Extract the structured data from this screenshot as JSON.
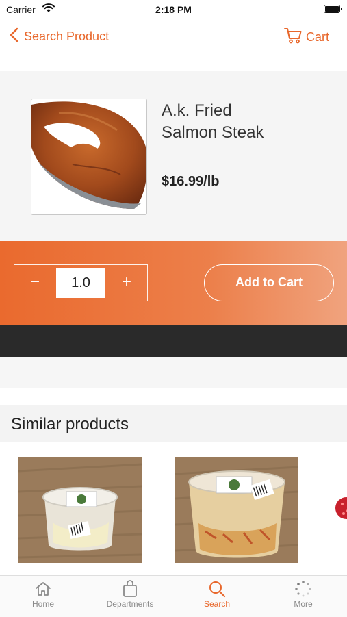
{
  "status_bar": {
    "carrier": "Carrier",
    "time": "2:18 PM"
  },
  "nav": {
    "back_label": "Search Product",
    "cart_label": "Cart"
  },
  "product": {
    "name_line1": "A.k. Fried",
    "name_line2": "Salmon Steak",
    "price": "$16.99/lb"
  },
  "quantity": {
    "minus": "−",
    "value": "1.0",
    "plus": "+"
  },
  "add_to_cart": "Add to Cart",
  "similar": {
    "title": "Similar products"
  },
  "tabs": [
    {
      "label": "Home",
      "icon": "home-icon"
    },
    {
      "label": "Departments",
      "icon": "bag-icon"
    },
    {
      "label": "Search",
      "icon": "search-icon",
      "active": true
    },
    {
      "label": "More",
      "icon": "more-dots-icon"
    }
  ],
  "colors": {
    "accent": "#e8672b",
    "dark_band": "#2a2a2a"
  }
}
